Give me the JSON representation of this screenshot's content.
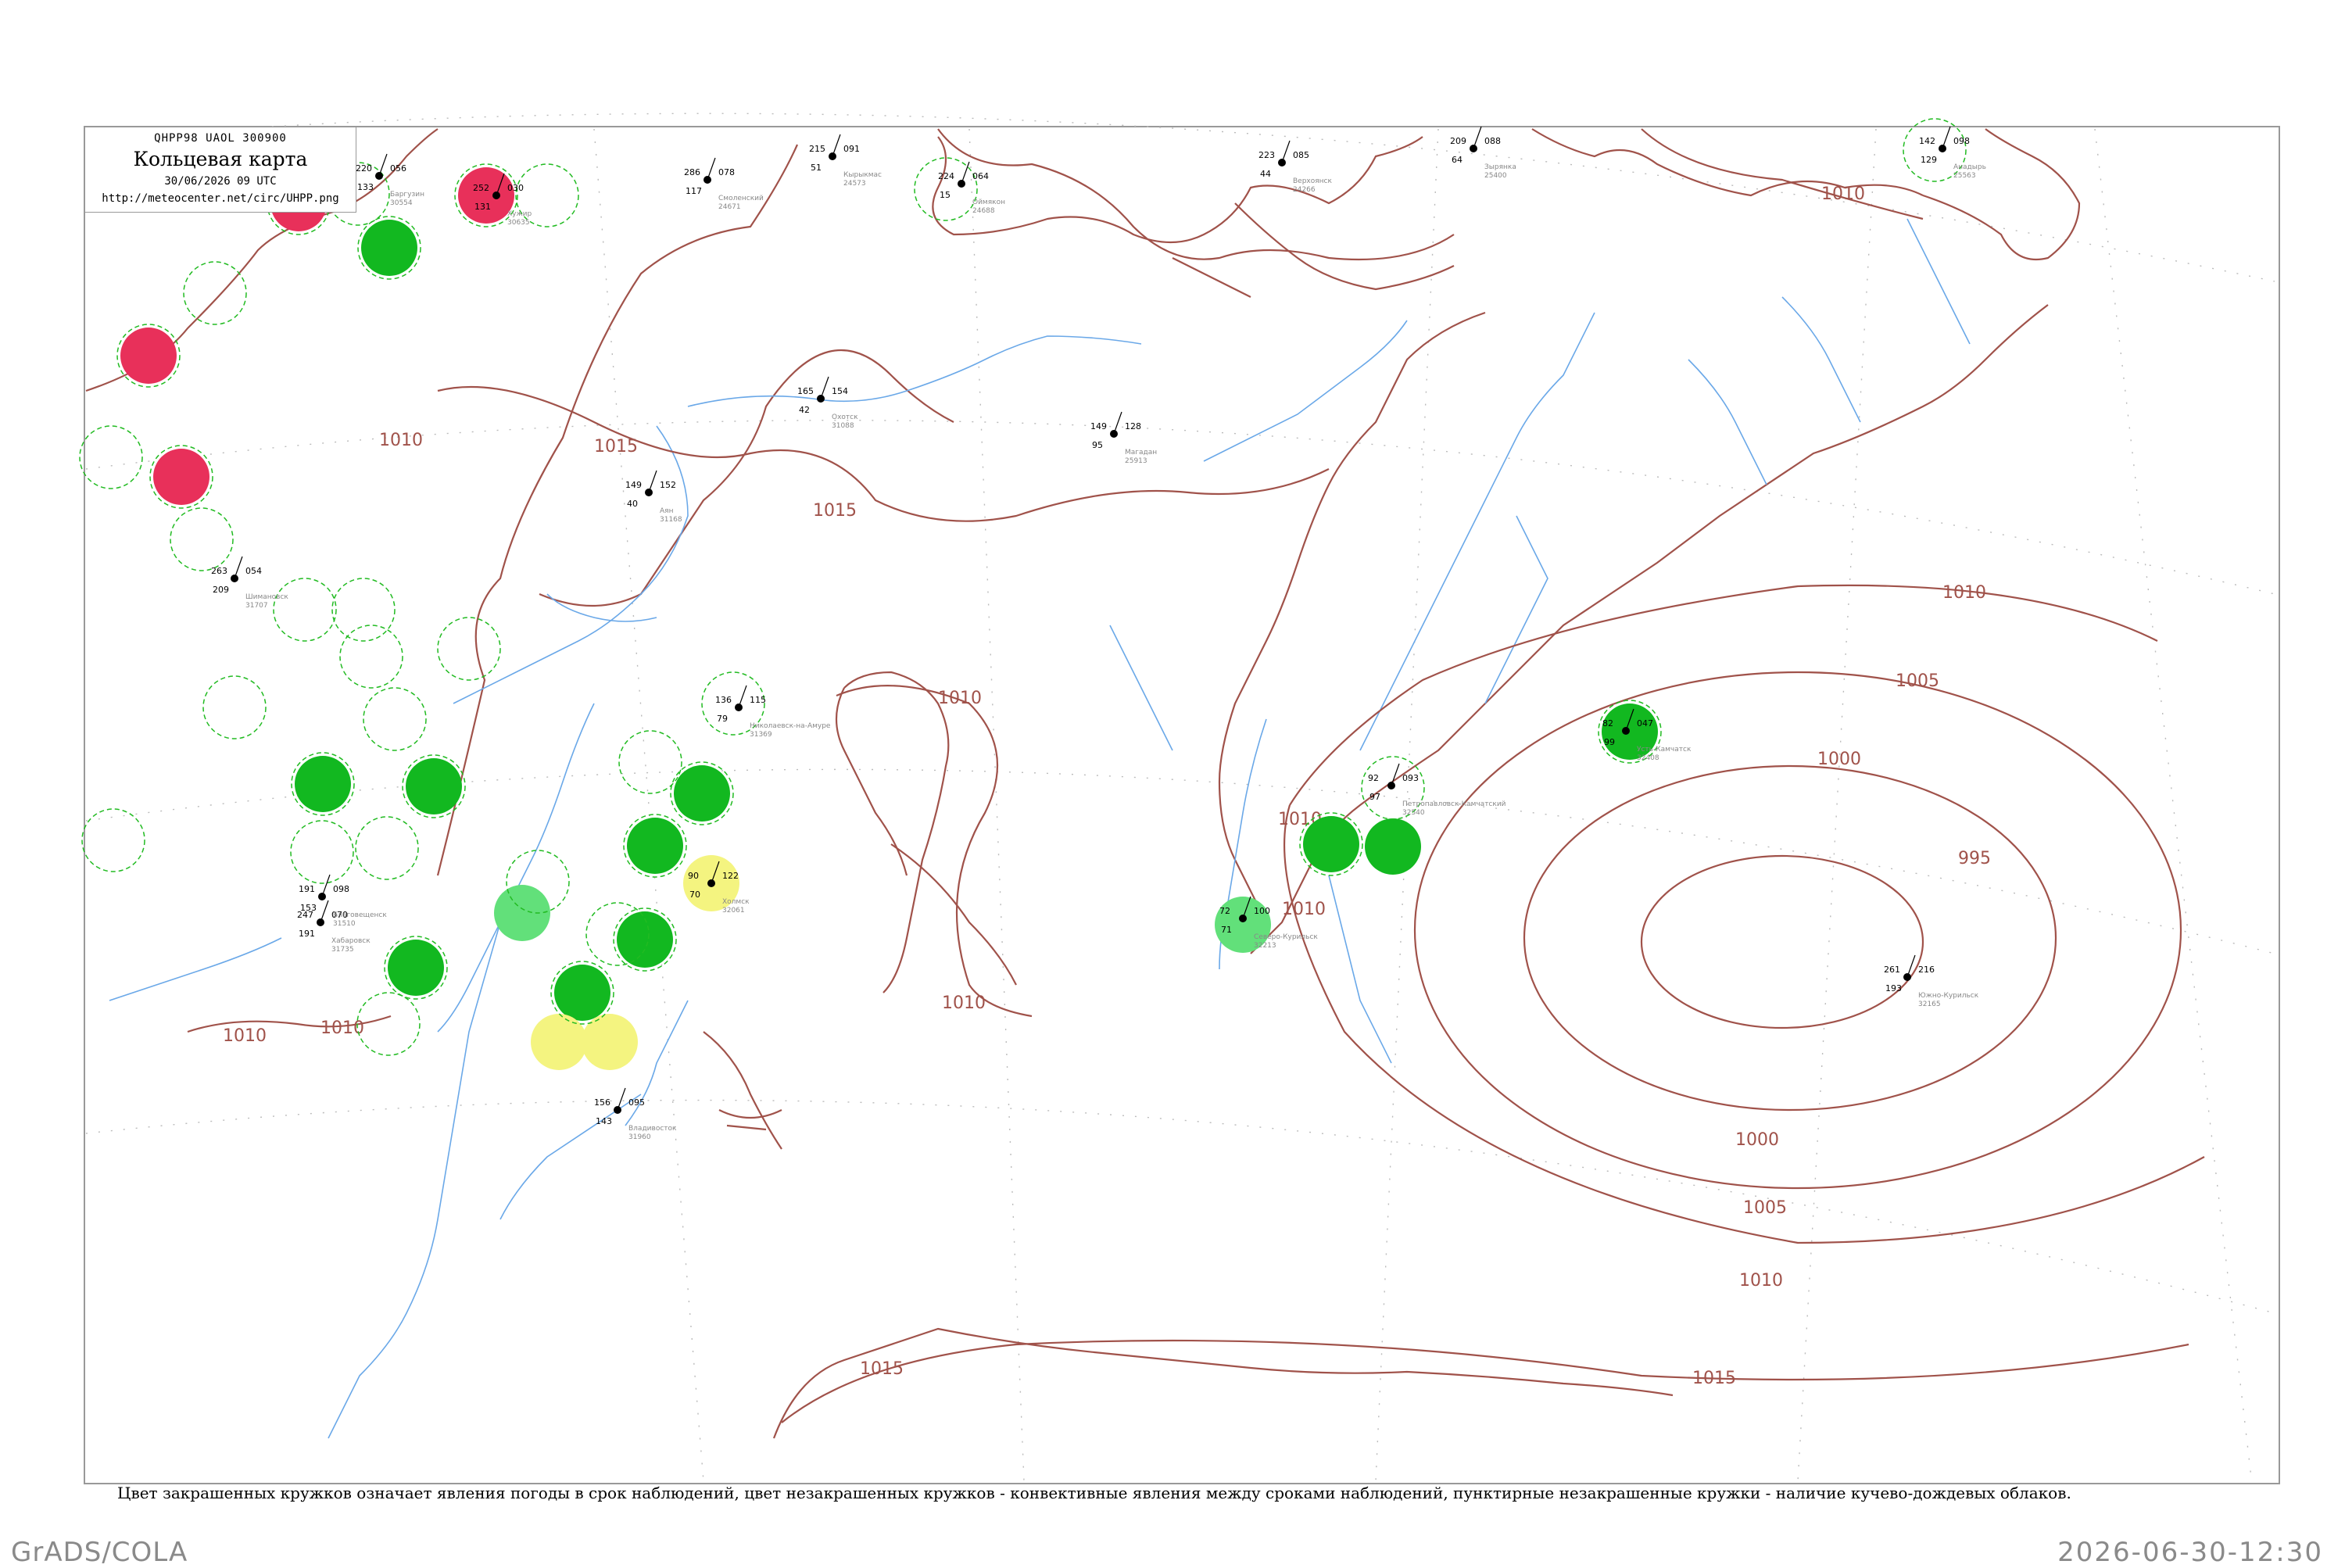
{
  "legend": {
    "code": "QHPP98  UAOL  300900",
    "title": "Кольцевая карта",
    "datetime": "30/06/2026 09 UTC",
    "url": "http://meteocenter.net/circ/UHPP.png"
  },
  "caption": "Цвет закрашенных кружков означает явления погоды в срок наблюдений, цвет незакрашенных кружков - конвективные явления между сроками наблюдений, пунктирные незакрашенные кружки - наличие кучево-дождевых облаков.",
  "footer": {
    "left": "GrADS/COLA",
    "right": "2026-06-30-12:30"
  },
  "colors": {
    "isobar": "#a0524a",
    "rivers": "#6aa8e8",
    "frame": "#999999",
    "thunderstorm_fill": "#e8305a",
    "rain_fill": "#12b820",
    "drizzle_fill": "#62e07a",
    "fog_fill": "#f4f480",
    "cb_dashed": "#22bb22"
  },
  "isobars": [
    "1015",
    "1010",
    "1005",
    "1000",
    "995"
  ],
  "stations": [
    {
      "name": "Смоленский",
      "id": "24671",
      "top": "078",
      "left": "286",
      "bottom": "117",
      "status": "clear"
    },
    {
      "name": "Баргузин",
      "id": "30554",
      "top": "056",
      "left": "220",
      "bottom": "133",
      "status": "thunderstorm"
    },
    {
      "name": "Хужир",
      "id": "30635",
      "top": "030",
      "left": "252",
      "bottom": "131",
      "status": "thunderstorm"
    },
    {
      "name": "Оймякон",
      "id": "24688",
      "top": "064",
      "left": "224",
      "bottom": "15",
      "status": "cb"
    },
    {
      "name": "Кырыкмас",
      "id": "24573",
      "top": "091",
      "left": "215",
      "bottom": "51",
      "status": "clear"
    },
    {
      "name": "Верхоянск",
      "id": "24266",
      "top": "085",
      "left": "223",
      "bottom": "44",
      "status": "clear"
    },
    {
      "name": "Зырянка",
      "id": "25400",
      "top": "088",
      "left": "209",
      "bottom": "64",
      "status": "clear"
    },
    {
      "name": "Анадырь",
      "id": "25563",
      "top": "098",
      "left": "142",
      "bottom": "129",
      "status": "cb"
    },
    {
      "name": "Усть-Камчатск",
      "id": "32408",
      "top": "047",
      "left": "82",
      "bottom": "99",
      "status": "rain"
    },
    {
      "name": "Петропавловск-Камчатский",
      "id": "32540",
      "top": "093",
      "left": "92",
      "bottom": "97",
      "status": "rain"
    },
    {
      "name": "Южно-Курильск",
      "id": "32165",
      "top": "216",
      "left": "261",
      "bottom": "193",
      "status": "clear"
    },
    {
      "name": "Северо-Курильск",
      "id": "32213",
      "top": "100",
      "left": "72",
      "bottom": "71",
      "status": "drizzle"
    },
    {
      "name": "Магадан",
      "id": "25913",
      "top": "128",
      "left": "149",
      "bottom": "95",
      "status": "clear"
    },
    {
      "name": "Охотск",
      "id": "31088",
      "top": "154",
      "left": "165",
      "bottom": "42",
      "status": "clear"
    },
    {
      "name": "Аян",
      "id": "31168",
      "top": "152",
      "left": "149",
      "bottom": "40",
      "status": "clear"
    },
    {
      "name": "Николаевск-на-Амуре",
      "id": "31369",
      "top": "115",
      "left": "136",
      "bottom": "79",
      "status": "cb"
    },
    {
      "name": "Хабаровск",
      "id": "31735",
      "top": "070",
      "left": "247",
      "bottom": "191",
      "status": "clear"
    },
    {
      "name": "Владивосток",
      "id": "31960",
      "top": "095",
      "left": "156",
      "bottom": "143",
      "status": "clear"
    },
    {
      "name": "Холмск",
      "id": "32061",
      "top": "122",
      "left": "90",
      "bottom": "70",
      "status": "fog"
    },
    {
      "name": "Шимановск",
      "id": "31707",
      "top": "054",
      "left": "263",
      "bottom": "209",
      "status": "clear"
    },
    {
      "name": "Благовещенск",
      "id": "31510",
      "top": "098",
      "left": "191",
      "bottom": "153",
      "status": "clear"
    }
  ]
}
